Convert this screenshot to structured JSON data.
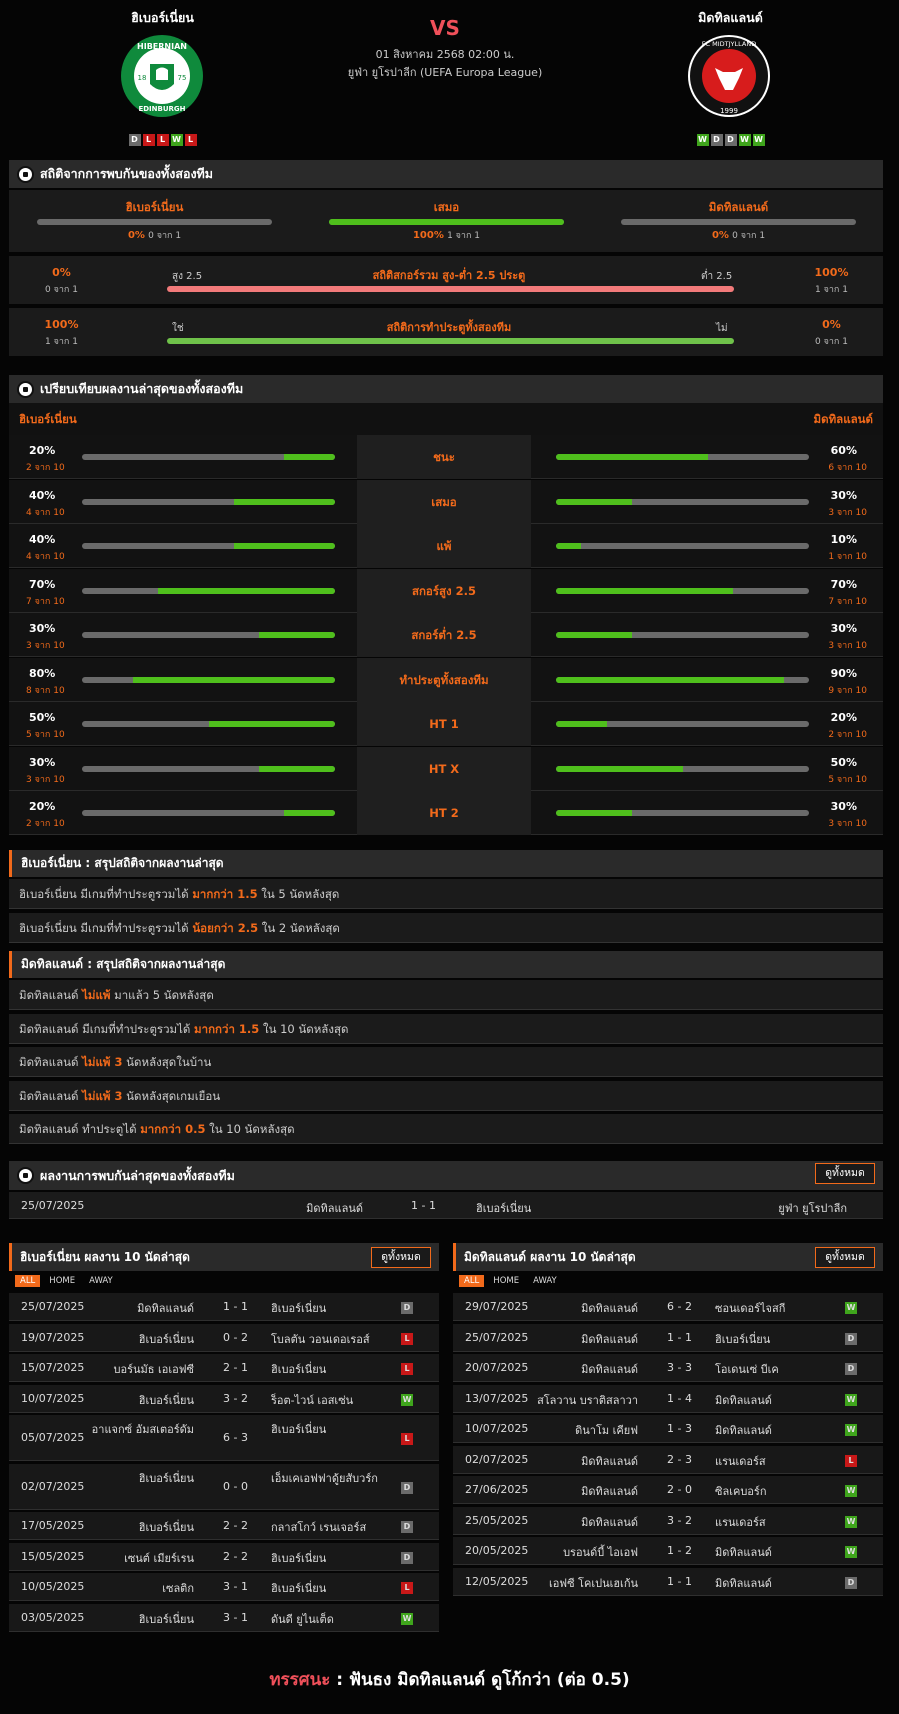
{
  "header": {
    "home": "ฮิเบอร์เนี่ยน",
    "away": "มิดทิลแลนด์",
    "vs": "VS",
    "date": "01 สิงหาคม 2568 02:00 น.",
    "league": "ยูฟ่า ยูโรปาลีก (UEFA Europa League)",
    "home_form": [
      "D",
      "L",
      "L",
      "W",
      "L"
    ],
    "away_form": [
      "W",
      "D",
      "D",
      "W",
      "W"
    ],
    "home_crest": {
      "top": "HIBERNIAN",
      "bottom": "EDINBURGH",
      "l": "18",
      "r": "75"
    },
    "away_crest": {
      "ring": "FC MIDTJYLLAND",
      "year": "1999"
    }
  },
  "h2h": {
    "title": "สถิติจากการพบกันของทั้งสองทีม",
    "home": {
      "name": "ฮิเบอร์เนี่ยน",
      "pct": "0%",
      "sub": "0 จาก 1",
      "v": 0
    },
    "draw": {
      "name": "เสมอ",
      "pct": "100%",
      "sub": "1 จาก 1",
      "v": 100
    },
    "away": {
      "name": "มิดทิลแลนด์",
      "pct": "0%",
      "sub": "0 จาก 1",
      "v": 0
    },
    "ou": {
      "title": "สถิติสกอร์รวม สูง-ต่ำ 2.5 ประตู",
      "lp": "0%",
      "ls": "0 จาก 1",
      "ll": "สูง 2.5",
      "rp": "100%",
      "rs": "1 จาก 1",
      "rl": "ต่ำ 2.5"
    },
    "btts": {
      "title": "สถิติการทำประตูทั้งสองทีม",
      "lp": "100%",
      "ls": "1 จาก 1",
      "ll": "ใช่",
      "rp": "0%",
      "rs": "0 จาก 1",
      "rl": "ไม่"
    }
  },
  "compare": {
    "title": "เปรียบเทียบผลงานล่าสุดของทั้งสองทีม",
    "home": "ฮิเบอร์เนี่ยน",
    "away": "มิดทิลแลนด์",
    "rows": [
      {
        "label": "ชนะ",
        "hp": "20%",
        "hs": "2 จาก 10",
        "hv": 20,
        "ap": "60%",
        "as": "6 จาก 10",
        "av": 60
      },
      {
        "label": "เสมอ",
        "hp": "40%",
        "hs": "4 จาก 10",
        "hv": 40,
        "ap": "30%",
        "as": "3 จาก 10",
        "av": 30
      },
      {
        "label": "แพ้",
        "hp": "40%",
        "hs": "4 จาก 10",
        "hv": 40,
        "ap": "10%",
        "as": "1 จาก 10",
        "av": 10
      },
      {
        "label": "สกอร์สูง 2.5",
        "hp": "70%",
        "hs": "7 จาก 10",
        "hv": 70,
        "ap": "70%",
        "as": "7 จาก 10",
        "av": 70
      },
      {
        "label": "สกอร์ต่ำ 2.5",
        "hp": "30%",
        "hs": "3 จาก 10",
        "hv": 30,
        "ap": "30%",
        "as": "3 จาก 10",
        "av": 30
      },
      {
        "label": "ทำประตูทั้งสองทีม",
        "hp": "80%",
        "hs": "8 จาก 10",
        "hv": 80,
        "ap": "90%",
        "as": "9 จาก 10",
        "av": 90
      },
      {
        "label": "HT 1",
        "hp": "50%",
        "hs": "5 จาก 10",
        "hv": 50,
        "ap": "20%",
        "as": "2 จาก 10",
        "av": 20
      },
      {
        "label": "HT X",
        "hp": "30%",
        "hs": "3 จาก 10",
        "hv": 30,
        "ap": "50%",
        "as": "5 จาก 10",
        "av": 50
      },
      {
        "label": "HT 2",
        "hp": "20%",
        "hs": "2 จาก 10",
        "hv": 20,
        "ap": "30%",
        "as": "3 จาก 10",
        "av": 30
      }
    ]
  },
  "home_summary": {
    "title": "ฮิเบอร์เนี่ยน : สรุปสถิติจากผลงานล่าสุด",
    "lines": [
      [
        "ฮิเบอร์เนี่ยน มีเกมที่ทำประตูรวมได้ ",
        "มากกว่า 1.5",
        " ใน 5 นัดหลังสุด"
      ],
      [
        "ฮิเบอร์เนี่ยน มีเกมที่ทำประตูรวมได้ ",
        "น้อยกว่า 2.5",
        " ใน 2 นัดหลังสุด"
      ]
    ]
  },
  "away_summary": {
    "title": "มิดทิลแลนด์ : สรุปสถิติจากผลงานล่าสุด",
    "lines": [
      [
        "มิดทิลแลนด์ ",
        "ไม่แพ้",
        " มาแล้ว 5 นัดหลังสุด"
      ],
      [
        "มิดทิลแลนด์ มีเกมที่ทำประตูรวมได้ ",
        "มากกว่า 1.5",
        " ใน 10 นัดหลังสุด"
      ],
      [
        "มิดทิลแลนด์ ",
        "ไม่แพ้ 3",
        " นัดหลังสุดในบ้าน"
      ],
      [
        "มิดทิลแลนด์ ",
        "ไม่แพ้ 3",
        " นัดหลังสุดเกมเยือน"
      ],
      [
        "มิดทิลแลนด์ ทำประตูได้ ",
        "มากกว่า 0.5",
        " ใน 10 นัดหลังสุด"
      ]
    ]
  },
  "h2h_results": {
    "title": "ผลงานการพบกันล่าสุดของทั้งสองทีม",
    "view_all": "ดูทั้งหมด",
    "rows": [
      {
        "date": "25/07/2025",
        "home": "มิดทิลแลนด์",
        "score": "1 - 1",
        "away": "ฮิเบอร์เนี่ยน",
        "comp": "ยูฟ่า ยูโรปาลีก"
      }
    ]
  },
  "home_last": {
    "title": "ฮิเบอร์เนี่ยน ผลงาน 10 นัดล่าสุด",
    "view_all": "ดูทั้งหมด",
    "tabs": [
      "ALL",
      "HOME",
      "AWAY"
    ],
    "rows": [
      {
        "date": "25/07/2025",
        "home": "มิดทิลแลนด์",
        "score": "1 - 1",
        "away": "ฮิเบอร์เนี่ยน",
        "r": "D"
      },
      {
        "date": "19/07/2025",
        "home": "ฮิเบอร์เนี่ยน",
        "score": "0 - 2",
        "away": "โบลตัน วอนเดอเรอส์",
        "r": "L"
      },
      {
        "date": "15/07/2025",
        "home": "บอร์นมัธ เอเอฟซี",
        "score": "2 - 1",
        "away": "ฮิเบอร์เนี่ยน",
        "r": "L"
      },
      {
        "date": "10/07/2025",
        "home": "ฮิเบอร์เนี่ยน",
        "score": "3 - 2",
        "away": "ร็อต-ไวน์ เอสเซ่น",
        "r": "W"
      },
      {
        "date": "05/07/2025",
        "home": "อาแจกซ์ อัมสเตอร์ดัม",
        "score": "6 - 3",
        "away": "ฮิเบอร์เนี่ยน",
        "r": "L"
      },
      {
        "date": "02/07/2025",
        "home": "ฮิเบอร์เนี่ยน",
        "score": "0 - 0",
        "away": "เอ็มเคเอฟฟาดู้ยสับวร์ก",
        "r": "D"
      },
      {
        "date": "17/05/2025",
        "home": "ฮิเบอร์เนี่ยน",
        "score": "2 - 2",
        "away": "กลาสโกว์ เรนเจอร์ส",
        "r": "D"
      },
      {
        "date": "15/05/2025",
        "home": "เซนต์ เมียร์เรน",
        "score": "2 - 2",
        "away": "ฮิเบอร์เนี่ยน",
        "r": "D"
      },
      {
        "date": "10/05/2025",
        "home": "เซลติก",
        "score": "3 - 1",
        "away": "ฮิเบอร์เนี่ยน",
        "r": "L"
      },
      {
        "date": "03/05/2025",
        "home": "ฮิเบอร์เนี่ยน",
        "score": "3 - 1",
        "away": "ดันดี ยูไนเต็ด",
        "r": "W"
      }
    ]
  },
  "away_last": {
    "title": "มิดทิลแลนด์ ผลงาน 10 นัดล่าสุด",
    "view_all": "ดูทั้งหมด",
    "tabs": [
      "ALL",
      "HOME",
      "AWAY"
    ],
    "rows": [
      {
        "date": "29/07/2025",
        "home": "มิดทิลแลนด์",
        "score": "6 - 2",
        "away": "ซอนเดอร์ไจสกี",
        "r": "W"
      },
      {
        "date": "25/07/2025",
        "home": "มิดทิลแลนด์",
        "score": "1 - 1",
        "away": "ฮิเบอร์เนี่ยน",
        "r": "D"
      },
      {
        "date": "20/07/2025",
        "home": "มิดทิลแลนด์",
        "score": "3 - 3",
        "away": "โอเดนเซ่ บีเค",
        "r": "D"
      },
      {
        "date": "13/07/2025",
        "home": "สโลวาน บราติสลาวา",
        "score": "1 - 4",
        "away": "มิดทิลแลนด์",
        "r": "W"
      },
      {
        "date": "10/07/2025",
        "home": "ดินาโม เคียฟ",
        "score": "1 - 3",
        "away": "มิดทิลแลนด์",
        "r": "W"
      },
      {
        "date": "02/07/2025",
        "home": "มิดทิลแลนด์",
        "score": "2 - 3",
        "away": "แรนเดอร์ส",
        "r": "L"
      },
      {
        "date": "27/06/2025",
        "home": "มิดทิลแลนด์",
        "score": "2 - 0",
        "away": "ซิลเคบอร์ก",
        "r": "W"
      },
      {
        "date": "25/05/2025",
        "home": "มิดทิลแลนด์",
        "score": "3 - 2",
        "away": "แรนเดอร์ส",
        "r": "W"
      },
      {
        "date": "20/05/2025",
        "home": "บรอนด์บี้ ไอเอฟ",
        "score": "1 - 2",
        "away": "มิดทิลแลนด์",
        "r": "W"
      },
      {
        "date": "12/05/2025",
        "home": "เอฟซี โคเปนเฮเก้น",
        "score": "1 - 1",
        "away": "มิดทิลแลนด์",
        "r": "D"
      }
    ]
  },
  "verdict": {
    "label": "ทรรศนะ",
    "sep": ":",
    "text": "ฟันธง มิดทิลแลนด์ ดูโก้กว่า (ต่อ 0.5)"
  }
}
